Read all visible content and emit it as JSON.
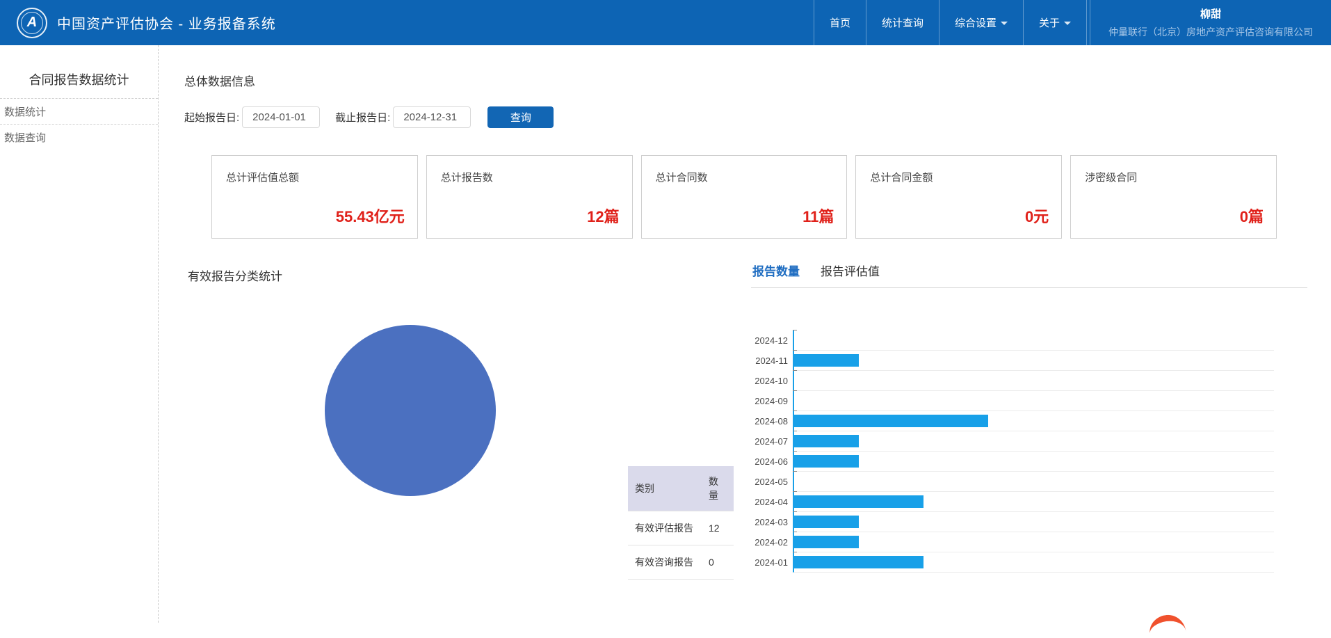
{
  "navbar": {
    "title": "中国资产评估协会 - 业务报备系统",
    "items": [
      {
        "label": "首页",
        "dropdown": false
      },
      {
        "label": "统计查询",
        "dropdown": false
      },
      {
        "label": "综合设置",
        "dropdown": true
      },
      {
        "label": "关于",
        "dropdown": true
      }
    ],
    "user": {
      "name": "柳甜",
      "company": "仲量联行（北京）房地产资产评估咨询有限公司"
    }
  },
  "sidebar": {
    "title": "合同报告数据统计",
    "items": [
      {
        "label": "数据统计"
      },
      {
        "label": "数据查询"
      }
    ]
  },
  "main": {
    "section_title": "总体数据信息",
    "filter": {
      "start_label": "起始报告日:",
      "start_value": "2024-01-01",
      "end_label": "截止报告日:",
      "end_value": "2024-12-31",
      "search_button": "查询"
    },
    "stat_cards": [
      {
        "label": "总计评估值总额",
        "value": "55.43亿元"
      },
      {
        "label": "总计报告数",
        "value": "12篇"
      },
      {
        "label": "总计合同数",
        "value": "11篇"
      },
      {
        "label": "总计合同金额",
        "value": "0元"
      },
      {
        "label": "涉密级合同",
        "value": "0篇"
      }
    ],
    "pie_section_title": "有效报告分类统计",
    "tabs": [
      {
        "label": "报告数量",
        "active": true
      },
      {
        "label": "报告评估值",
        "active": false
      }
    ],
    "category_table": {
      "headers": [
        "类别",
        "数量"
      ],
      "rows": [
        {
          "category": "有效评估报告",
          "count": "12"
        },
        {
          "category": "有效咨询报告",
          "count": "0"
        }
      ]
    }
  },
  "chart_data": [
    {
      "type": "pie",
      "title": "有效报告分类统计",
      "labels": [
        "有效评估报告",
        "有效咨询报告"
      ],
      "values": [
        12,
        0
      ],
      "colors": [
        "#4b70c0"
      ],
      "legend_position": "none"
    },
    {
      "type": "bar",
      "orientation": "horizontal",
      "title": "报告数量",
      "categories": [
        "2024-12",
        "2024-11",
        "2024-10",
        "2024-09",
        "2024-08",
        "2024-07",
        "2024-06",
        "2024-05",
        "2024-04",
        "2024-03",
        "2024-02",
        "2024-01"
      ],
      "values": [
        0,
        1,
        0,
        0,
        3,
        1,
        1,
        0,
        2,
        1,
        1,
        2
      ],
      "bar_color": "#18a0e8",
      "xlim": [
        0,
        3
      ],
      "grid": true,
      "x_axis_labels_visible": false
    }
  ],
  "colors": {
    "navbar_bg": "#0d64b4",
    "accent_red": "#e0211a",
    "button_blue": "#1266b4",
    "active_tab_blue": "#1f6dc1",
    "bar_blue": "#18a0e8",
    "pie_blue": "#4b70c0",
    "table_header_bg": "#dadaeb"
  }
}
